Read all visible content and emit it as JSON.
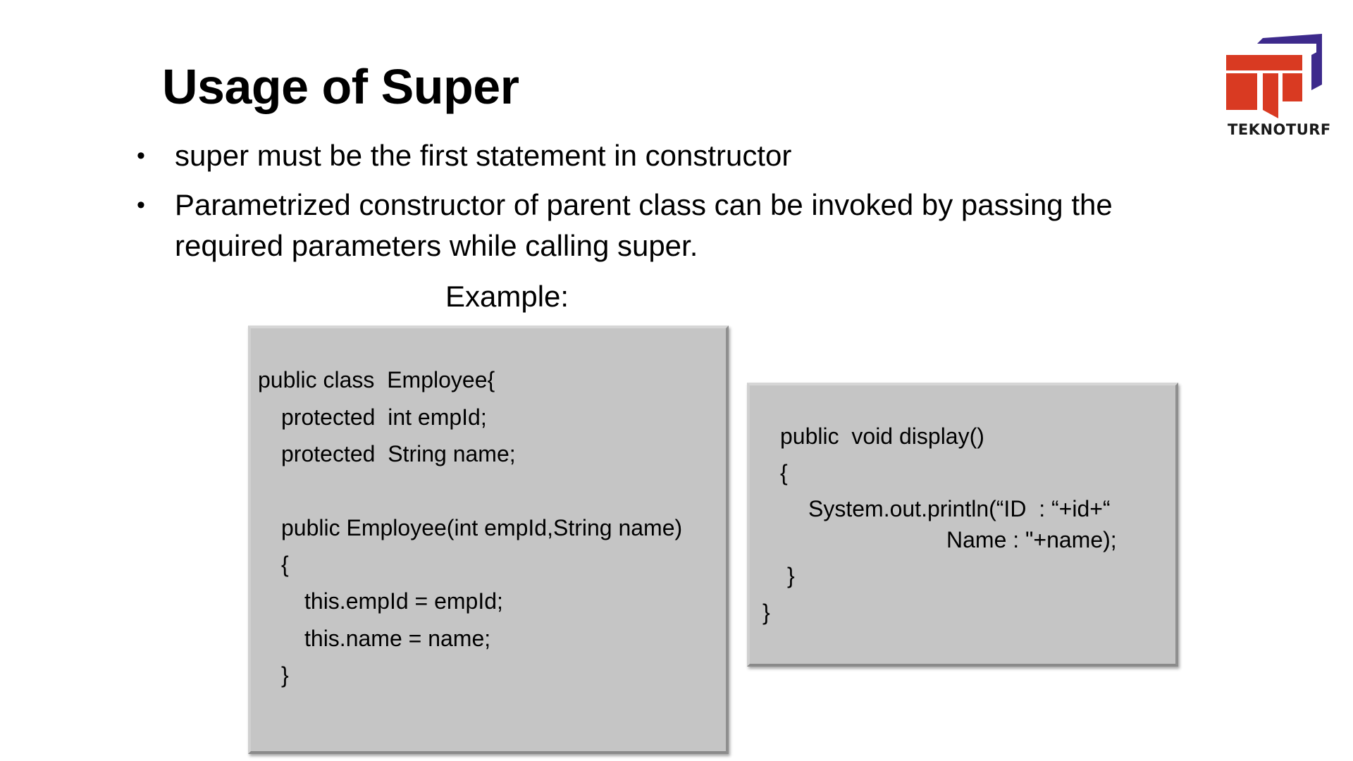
{
  "slide": {
    "title": "Usage of Super",
    "bullets": [
      "super must be the first statement in constructor",
      "Parametrized constructor of parent class can be invoked by passing the required parameters while calling super."
    ],
    "bullet_marker": "•",
    "example_label": "Example:"
  },
  "code_left": {
    "lines": [
      "public class  Employee{",
      "protected  int empId;",
      "protected  String name;",
      "public Employee(int empId,String name)",
      "{",
      "this.empId = empId;",
      "this.name = name;",
      "}"
    ]
  },
  "code_right": {
    "lines": [
      "public  void display()",
      "{",
      "System.out.println(“ID  : “+id+“",
      "Name : \"+name);",
      "}",
      "}"
    ]
  },
  "logo": {
    "text": "TEKNOTURF",
    "colors": {
      "red": "#d93a22",
      "purple": "#3d2a8c"
    }
  },
  "colors": {
    "code_box_fill": "#c5c5c5",
    "text": "#000000"
  }
}
